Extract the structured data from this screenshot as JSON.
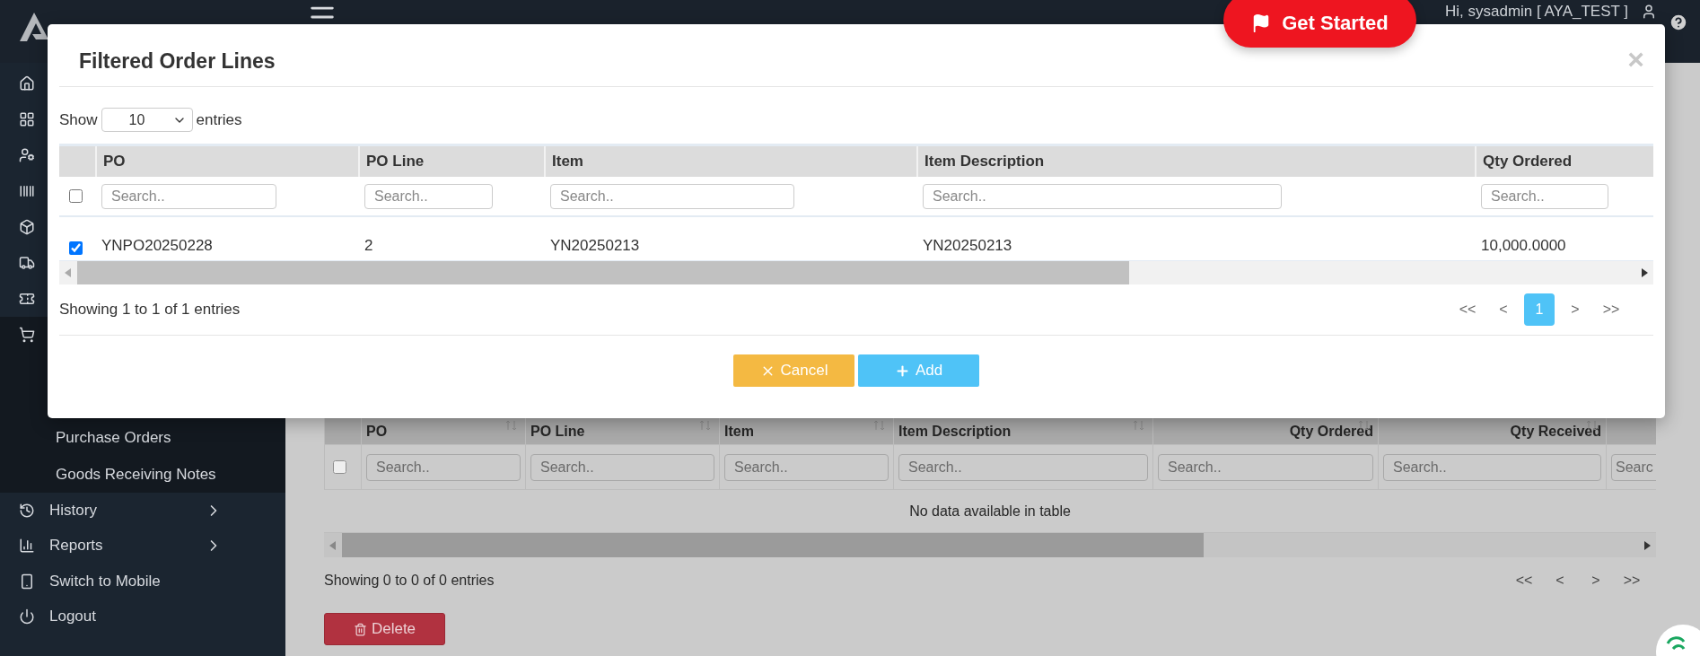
{
  "topbar": {
    "get_started": "Get Started",
    "greeting": "Hi, sysadmin [ AYA_TEST ]"
  },
  "sidebar": {
    "sub_items": [
      "Purchase Orders",
      "Goods Receiving Notes"
    ],
    "items": [
      {
        "kind": "history",
        "label": "History",
        "has_submenu": true
      },
      {
        "kind": "reports",
        "label": "Reports",
        "has_submenu": true
      },
      {
        "kind": "mobile",
        "label": "Switch to Mobile",
        "has_submenu": false
      },
      {
        "kind": "logout",
        "label": "Logout",
        "has_submenu": false
      }
    ]
  },
  "page_table": {
    "columns": [
      {
        "title": "PO",
        "placeholder": "Search..",
        "kind": "text"
      },
      {
        "title": "PO Line",
        "placeholder": "Search..",
        "kind": "text"
      },
      {
        "title": "Item",
        "placeholder": "Search..",
        "kind": "text"
      },
      {
        "title": "Item Description",
        "placeholder": "Search..",
        "kind": "text"
      },
      {
        "title": "Qty Ordered",
        "placeholder": "Search..",
        "kind": "number"
      },
      {
        "title": "Qty Received",
        "placeholder": "Search..",
        "kind": "number"
      },
      {
        "placeholder": "Searc",
        "kind": "text"
      }
    ],
    "select_all_checked": false,
    "empty_message": "No data available in table",
    "info": "Showing 0 to 0 of 0 entries",
    "pager": [
      {
        "label": "<<",
        "selected": false
      },
      {
        "label": "<",
        "selected": false
      },
      {
        "label": ">",
        "selected": false
      },
      {
        "label": ">>",
        "selected": false
      }
    ],
    "delete": "Delete"
  },
  "modal": {
    "title": "Filtered Order Lines",
    "close": "×",
    "show_label": "Show",
    "page_length": "10",
    "entries_label": "entries",
    "columns": [
      {
        "title": "PO",
        "placeholder": "Search.."
      },
      {
        "title": "PO Line",
        "placeholder": "Search.."
      },
      {
        "title": "Item",
        "placeholder": "Search.."
      },
      {
        "title": "Item Description",
        "placeholder": "Search.."
      },
      {
        "title": "Qty Ordered",
        "placeholder": "Search.."
      }
    ],
    "select_all_checked": false,
    "rows": [
      {
        "checked": true,
        "cells": [
          "YNPO20250228",
          "2",
          "YN20250213",
          "YN20250213",
          "10,000.0000"
        ]
      }
    ],
    "info": "Showing 1 to 1 of 1 entries",
    "pager": [
      {
        "label": "<<",
        "selected": false
      },
      {
        "label": "<",
        "selected": false
      },
      {
        "label": "1",
        "selected": true
      },
      {
        "label": ">",
        "selected": false
      },
      {
        "label": ">>",
        "selected": false
      }
    ],
    "buttons": [
      {
        "kind": "cancel",
        "label": "Cancel"
      },
      {
        "kind": "add",
        "label": "Add"
      }
    ]
  }
}
